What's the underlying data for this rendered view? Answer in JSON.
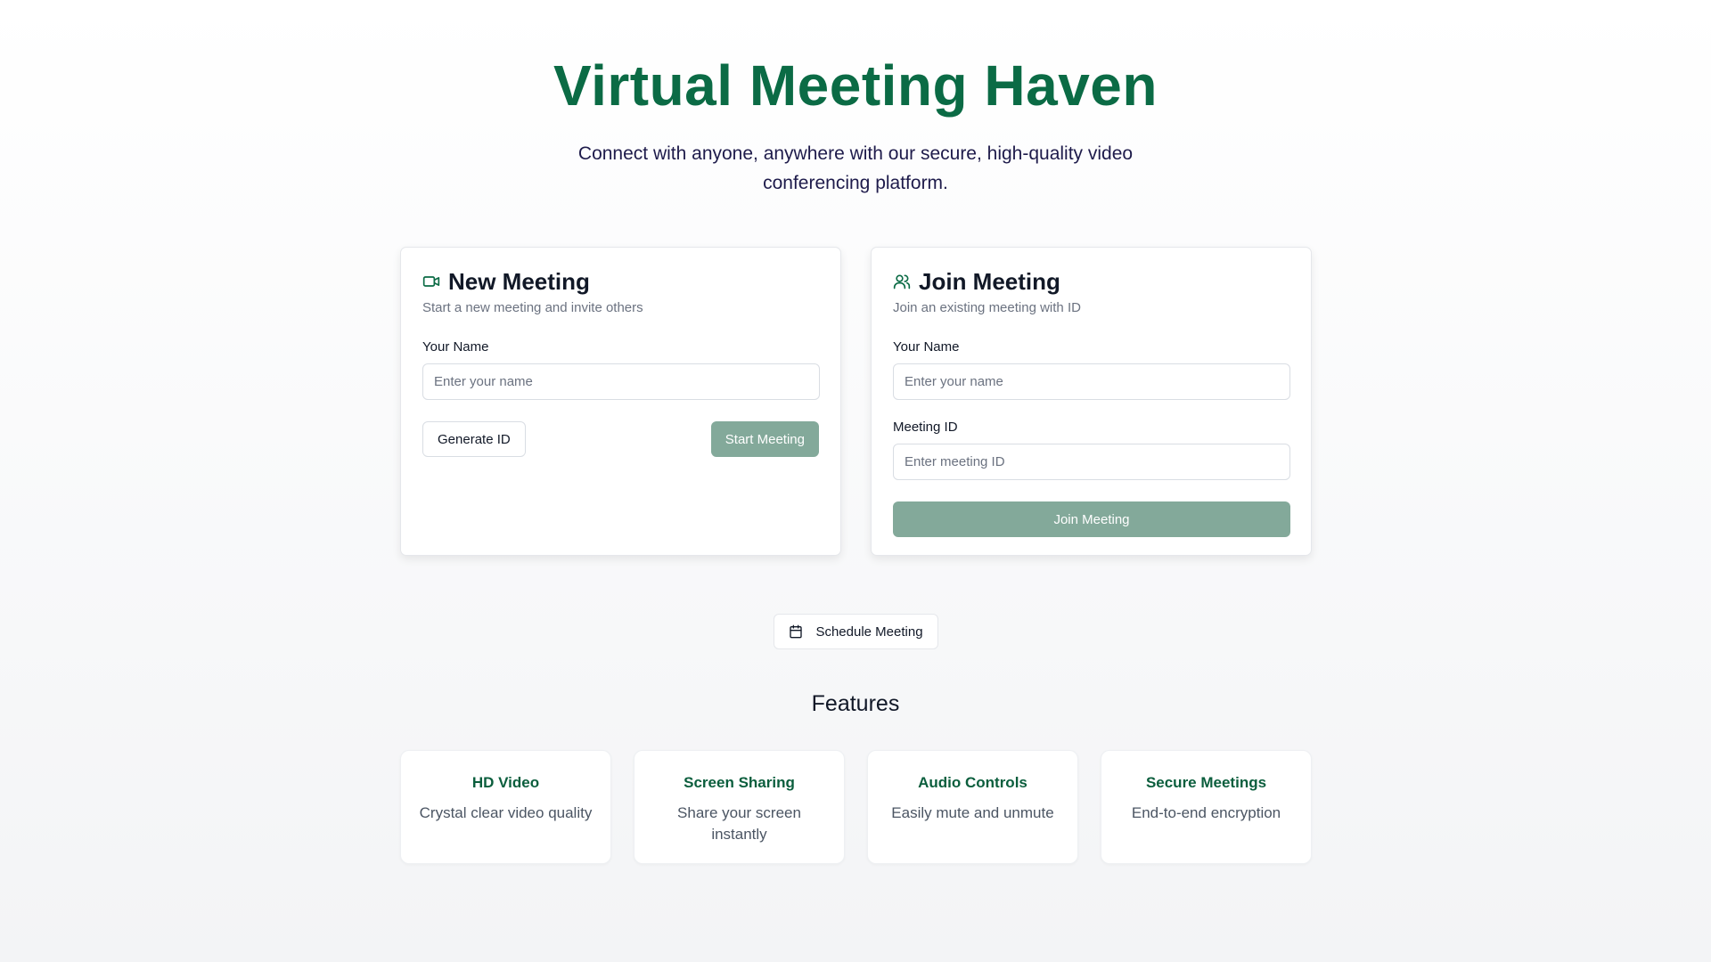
{
  "hero": {
    "title": "Virtual Meeting Haven",
    "subtitle": "Connect with anyone, anywhere with our secure, high-quality video conferencing platform."
  },
  "new_meeting": {
    "icon": "video-icon",
    "title": "New Meeting",
    "subtitle": "Start a new meeting and invite others",
    "name_label": "Your Name",
    "name_placeholder": "Enter your name",
    "generate_label": "Generate ID",
    "start_label": "Start Meeting"
  },
  "join_meeting": {
    "icon": "users-icon",
    "title": "Join Meeting",
    "subtitle": "Join an existing meeting with ID",
    "name_label": "Your Name",
    "name_placeholder": "Enter your name",
    "id_label": "Meeting ID",
    "id_placeholder": "Enter meeting ID",
    "join_label": "Join Meeting"
  },
  "schedule": {
    "icon": "calendar-icon",
    "label": "Schedule Meeting"
  },
  "features": {
    "title": "Features",
    "items": [
      {
        "title": "HD Video",
        "description": "Crystal clear video quality"
      },
      {
        "title": "Screen Sharing",
        "description": "Share your screen instantly"
      },
      {
        "title": "Audio Controls",
        "description": "Easily mute and unmute"
      },
      {
        "title": "Secure Meetings",
        "description": "End-to-end encryption"
      }
    ]
  },
  "colors": {
    "brand": "#0b6b45",
    "primary_button": "#83a99a",
    "subtitle": "#1e1b4b"
  }
}
